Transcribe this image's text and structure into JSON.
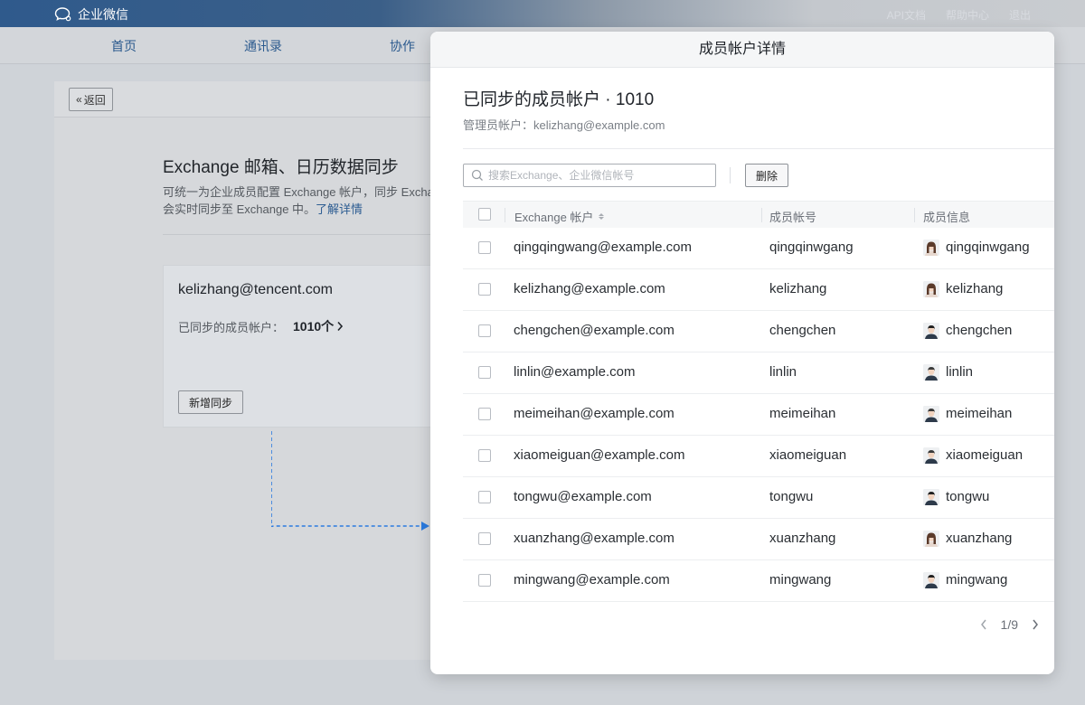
{
  "app": {
    "name": "企业微信",
    "toplinks": [
      "API文档",
      "帮助中心",
      "退出"
    ]
  },
  "nav": [
    "首页",
    "通讯录",
    "协作"
  ],
  "background": {
    "back_label": "返回",
    "title": "Exchange 邮箱、日历数据同步",
    "desc_line1": "可统一为企业成员配置 Exchange 帐户，同步 Excha",
    "desc_line2": "会实时同步至 Exchange 中。",
    "desc_link": "了解详情",
    "account_email": "kelizhang@tencent.com",
    "synced_label": "已同步的成员帐户：",
    "synced_count": "1010个",
    "add_sync_label": "新增同步"
  },
  "modal": {
    "header": "成员帐户详情",
    "title": "已同步的成员帐户 · 1010",
    "admin_label": "管理员帐户：kelizhang@example.com",
    "search_placeholder": "搜索Exchange、企业微信帐号",
    "delete_label": "删除",
    "columns": [
      "Exchange 帐户",
      "成员帐号",
      "成员信息"
    ],
    "rows": [
      {
        "email": "qingqingwang@example.com",
        "account": "qingqinwgang",
        "member": "qingqinwgang",
        "avatar": "female"
      },
      {
        "email": "kelizhang@example.com",
        "account": "kelizhang",
        "member": "kelizhang",
        "avatar": "female"
      },
      {
        "email": "chengchen@example.com",
        "account": "chengchen",
        "member": "chengchen",
        "avatar": "male-dark"
      },
      {
        "email": "linlin@example.com",
        "account": "linlin",
        "member": "linlin",
        "avatar": "male"
      },
      {
        "email": "meimeihan@example.com",
        "account": "meimeihan",
        "member": "meimeihan",
        "avatar": "male"
      },
      {
        "email": "xiaomeiguan@example.com",
        "account": "xiaomeiguan",
        "member": "xiaomeiguan",
        "avatar": "male"
      },
      {
        "email": "tongwu@example.com",
        "account": "tongwu",
        "member": "tongwu",
        "avatar": "male-dark"
      },
      {
        "email": "xuanzhang@example.com",
        "account": "xuanzhang",
        "member": "xuanzhang",
        "avatar": "female"
      },
      {
        "email": "mingwang@example.com",
        "account": "mingwang",
        "member": "mingwang",
        "avatar": "male-dark"
      }
    ],
    "pagination": "1/9"
  },
  "colors": {
    "accent": "#2d5d92",
    "arrow": "#2b7be0"
  }
}
